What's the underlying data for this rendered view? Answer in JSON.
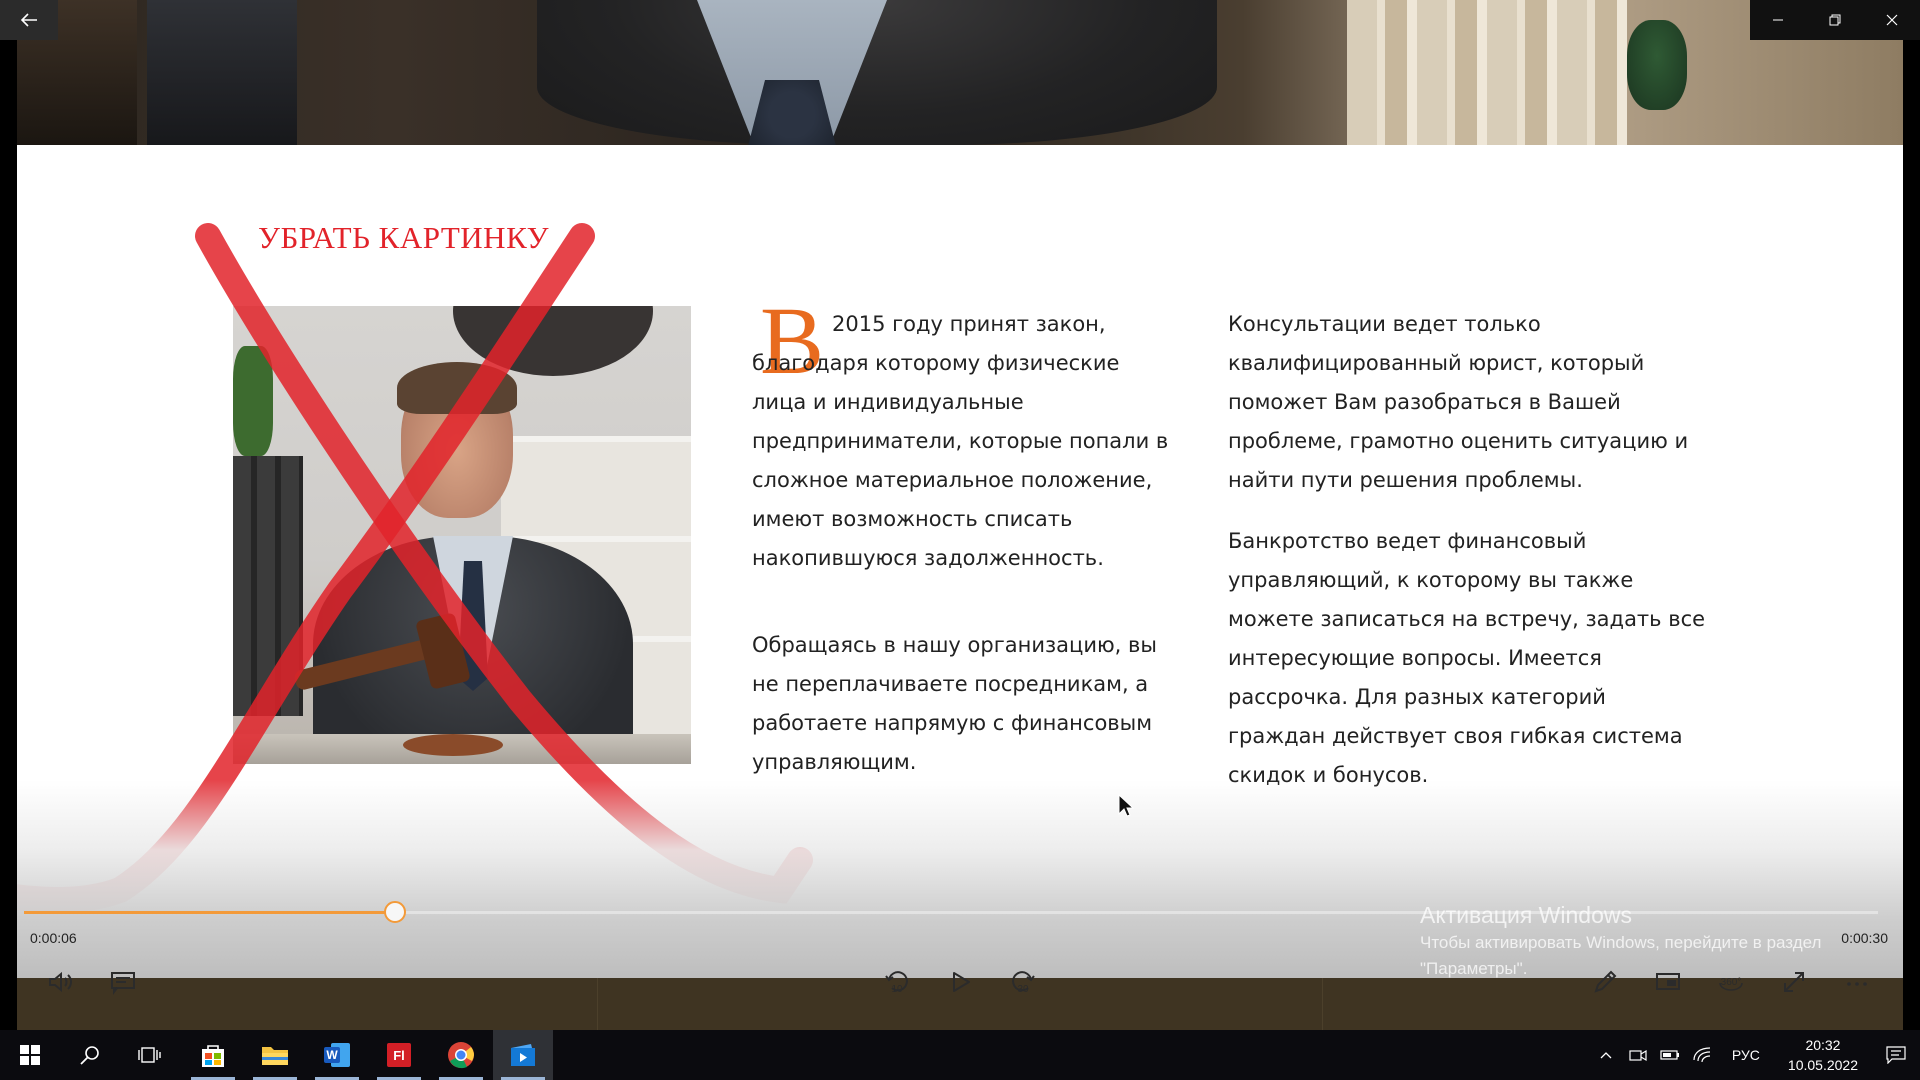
{
  "annotation": {
    "text": "УБРАТЬ КАРТИНКУ",
    "color": "#e2232a"
  },
  "article": {
    "drop_cap": "В",
    "col1": {
      "p1": "2015 году принят закон, благодаря которому физические лица и индивидуальные предприниматели, которые попали в сложное материальное положение, имеют возможность списать накопившуюся задолженность.",
      "p2": "Обращаясь в нашу организацию, вы не переплачиваете посредникам, а работаете напрямую с финансовым управляющим."
    },
    "col2": {
      "p1": "Консультации ведет только квалифицированный юрист, который поможет Вам разобраться в Вашей проблеме, грамотно оценить ситуацию и найти пути решения проблемы.",
      "p2": "Банкротство ведет финансовый управляющий, к которому вы также можете записаться на встречу, задать все интересующие вопросы. Имеется рассрочка. Для разных категорий граждан действует своя гибкая система скидок и бонусов."
    },
    "accent_color": "#e86b1f"
  },
  "player": {
    "current_time": "0:00:06",
    "total_time": "0:00:30",
    "progress_fraction": 0.2,
    "accent_color": "#f39a39",
    "controls": {
      "left": [
        "volume-icon",
        "subtitles-icon"
      ],
      "center": [
        "skip-back-10-icon",
        "play-icon",
        "skip-forward-30-icon"
      ],
      "right": [
        "pen-icon",
        "mini-view-icon",
        "360-icon",
        "fullscreen-icon",
        "more-icon"
      ]
    },
    "skip_back_label": "10",
    "skip_forward_label": "30",
    "vr_label": "360°"
  },
  "windows_activation": {
    "title": "Активация Windows",
    "line1": "Чтобы активировать Windows, перейдите в раздел",
    "line2": "\"Параметры\"."
  },
  "taskbar": {
    "apps": [
      "start-icon",
      "search-icon",
      "task-view-icon",
      "store-icon",
      "file-explorer-icon",
      "word-icon",
      "flash-icon",
      "chrome-icon",
      "movies-tv-icon"
    ],
    "language": "РУС",
    "time": "20:32",
    "date": "10.05.2022"
  }
}
